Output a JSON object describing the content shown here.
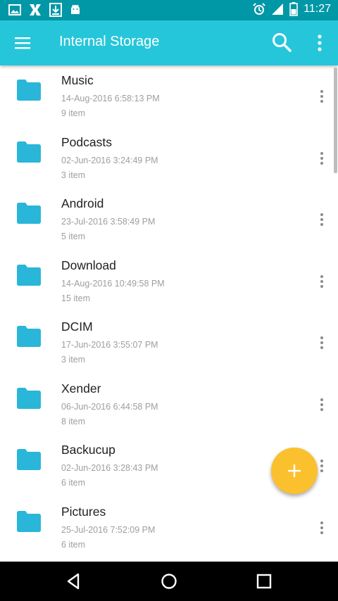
{
  "status_bar": {
    "time": "11:27",
    "left_icons": [
      "image-icon",
      "x-app-icon",
      "download-icon",
      "android-icon"
    ],
    "right_icons": [
      "alarm-icon",
      "signal-icon",
      "battery-icon"
    ]
  },
  "app_bar": {
    "title": "Internal Storage",
    "menu_icon": "hamburger-menu-icon",
    "search_icon": "search-icon",
    "overflow_icon": "more-vert-icon",
    "color": "#26c6da"
  },
  "colors": {
    "status_bar": "#0097a7",
    "folder": "#29b6d8",
    "fab": "#fbc02d"
  },
  "folders": [
    {
      "name": "Music",
      "date": "14-Aug-2016 6:58:13 PM",
      "count": "9 item"
    },
    {
      "name": "Podcasts",
      "date": "02-Jun-2016 3:24:49 PM",
      "count": "3 item"
    },
    {
      "name": "Android",
      "date": "23-Jul-2016 3:58:49 PM",
      "count": "5 item"
    },
    {
      "name": "Download",
      "date": "14-Aug-2016 10:49:58 PM",
      "count": "15 item"
    },
    {
      "name": "DCIM",
      "date": "17-Jun-2016 3:55:07 PM",
      "count": "3 item"
    },
    {
      "name": "Xender",
      "date": "06-Jun-2016 6:44:58 PM",
      "count": "8 item"
    },
    {
      "name": "Backucup",
      "date": "02-Jun-2016 3:28:43 PM",
      "count": "6 item"
    },
    {
      "name": "Pictures",
      "date": "25-Jul-2016 7:52:09 PM",
      "count": "6 item"
    }
  ],
  "fab": {
    "icon": "plus-icon"
  },
  "nav_bar": {
    "icons": [
      "back-icon",
      "home-icon",
      "recents-icon"
    ]
  }
}
